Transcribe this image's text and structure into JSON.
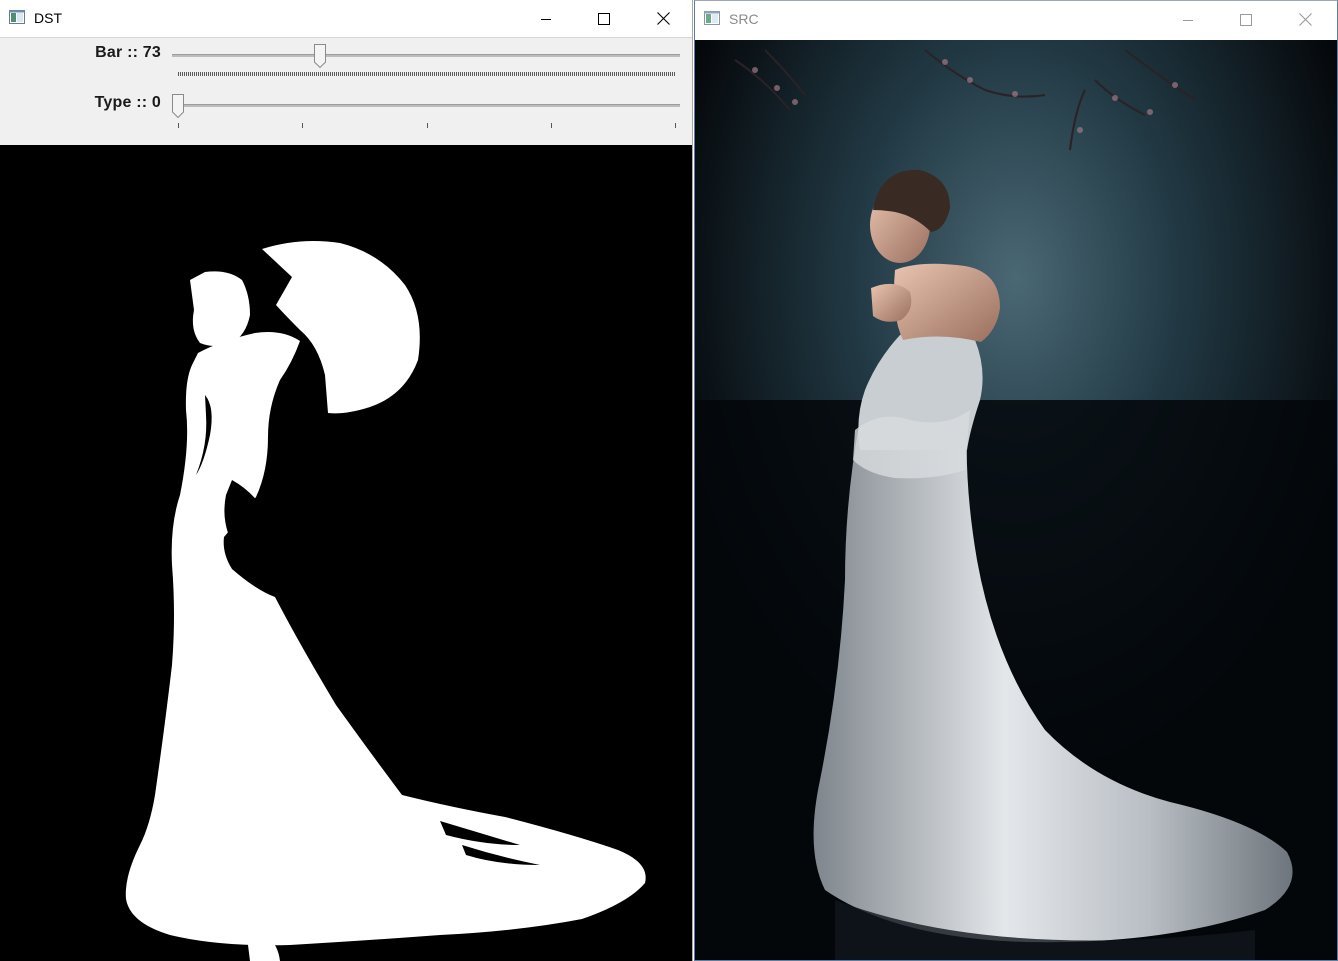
{
  "windows": {
    "dst": {
      "title": "DST",
      "trackbars": [
        {
          "label": "Bar :: 73",
          "value": 73,
          "max": 255
        },
        {
          "label": "Type :: 0",
          "value": 0,
          "max": 4
        }
      ]
    },
    "src": {
      "title": "SRC"
    }
  },
  "icons": {
    "app": "opencv-window-icon",
    "minimize": "minimize-icon",
    "maximize": "maximize-icon",
    "close": "close-icon"
  },
  "colors": {
    "titlebar": "#ffffff",
    "toolbar": "#f0f0f0",
    "dst_background": "#000000",
    "dst_foreground": "#ffffff",
    "src_background": "#05080b",
    "src_glow": "#3a5562",
    "inactive_title": "#8a8a8a"
  }
}
